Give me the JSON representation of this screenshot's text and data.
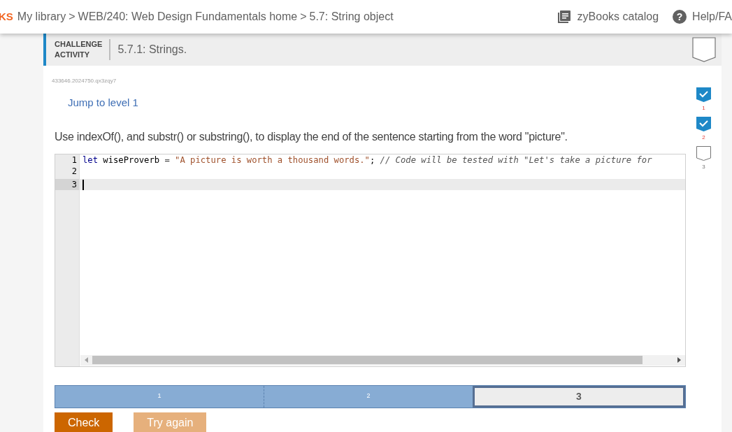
{
  "top_bar": {
    "logo_fragment": "KS",
    "breadcrumb": [
      "My library",
      ">",
      "WEB/240: Web Design Fundamentals home",
      ">",
      "5.7: String object"
    ],
    "catalog_link": "zyBooks catalog",
    "help_icon": "?",
    "help_link": "Help/FA"
  },
  "activity": {
    "type_label": [
      "CHALLENGE",
      "ACTIVITY"
    ],
    "title": "5.7.1: Strings.",
    "completed": false,
    "id_text": "433646.2024750.qx3zqy7",
    "jump_link": "Jump to level 1",
    "instructions": "Use indexOf(), and substr() or substring(), to display the end of the sentence starting from the word \"picture\".",
    "code_lines": [
      {
        "number": "1",
        "active": false,
        "tokens": [
          {
            "kind": "keyword",
            "text": "let"
          },
          {
            "kind": "plain",
            "text": " wiseProverb "
          },
          {
            "kind": "operator",
            "text": "= "
          },
          {
            "kind": "string",
            "text": "\"A picture is worth a thousand words.\""
          },
          {
            "kind": "plain",
            "text": "; "
          },
          {
            "kind": "comment",
            "text": "// Code will be tested with \"Let's take a picture for"
          }
        ]
      },
      {
        "number": "2",
        "active": false
      },
      {
        "number": "3",
        "active": true
      }
    ],
    "levels": [
      {
        "label": "1",
        "side_label": "1",
        "completed": true,
        "selected": false
      },
      {
        "label": "2",
        "side_label": "2",
        "completed": true,
        "selected": false
      },
      {
        "label": "3",
        "side_label": "3",
        "completed": false,
        "selected": true
      }
    ],
    "buttons": [
      {
        "label": "Check",
        "kind": "primary"
      },
      {
        "label": "Try again",
        "kind": "secondary"
      }
    ]
  }
}
